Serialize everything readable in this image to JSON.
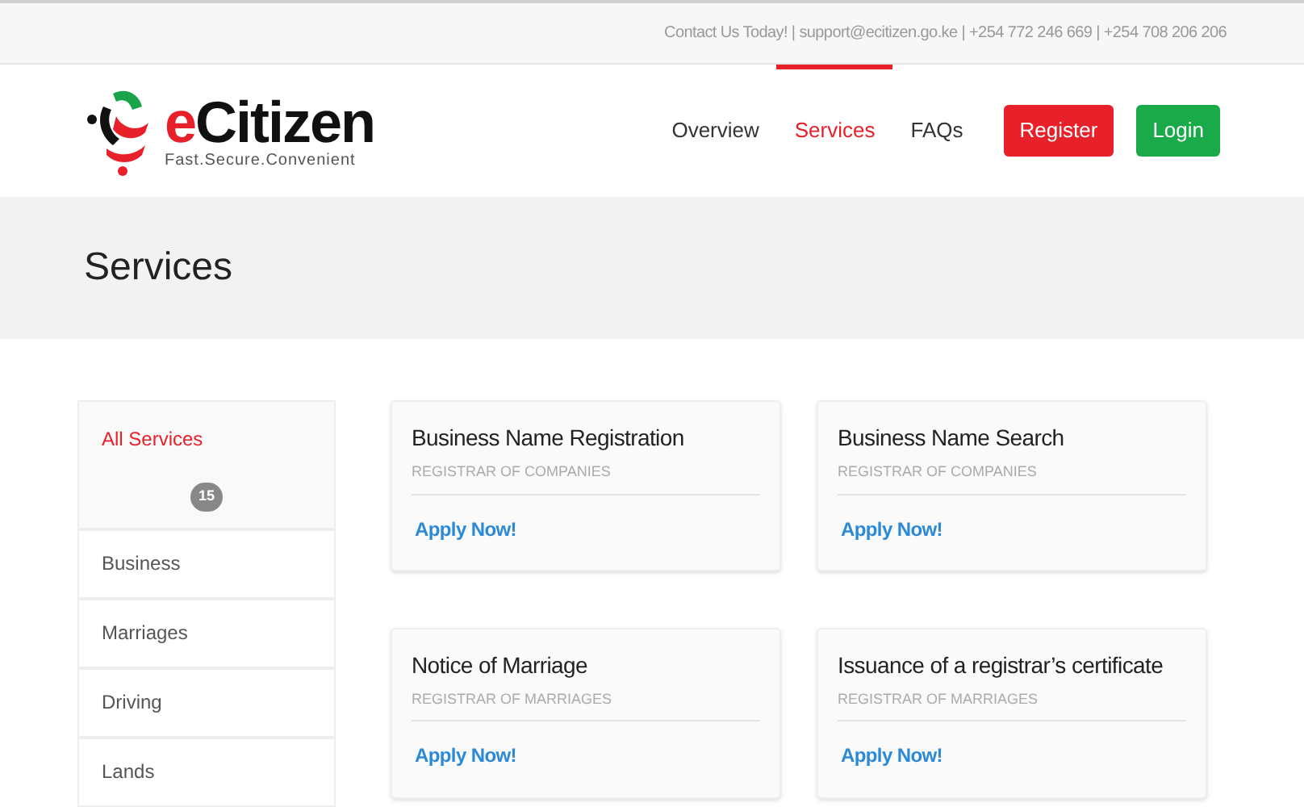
{
  "top_bar": {
    "contact": "Contact Us Today! | support@ecitizen.go.ke | +254 772 246 669 | +254 708 206 206"
  },
  "logo": {
    "accent": "e",
    "name": "Citizen",
    "tagline": "Fast.Secure.Convenient"
  },
  "nav": [
    {
      "label": "Overview",
      "selected": false
    },
    {
      "label": "Services",
      "selected": true
    },
    {
      "label": "FAQs",
      "selected": false
    }
  ],
  "buttons": [
    {
      "label": "Register",
      "kind": "register"
    },
    {
      "label": "Login",
      "kind": "login"
    }
  ],
  "page_title": "Services",
  "sidebar": {
    "items": [
      {
        "label": "All Services",
        "selected": true,
        "count": "15"
      },
      {
        "label": "Business",
        "selected": false
      },
      {
        "label": "Marriages",
        "selected": false
      },
      {
        "label": "Driving",
        "selected": false
      },
      {
        "label": "Lands",
        "selected": false
      }
    ]
  },
  "cards": [
    {
      "title": "Business Name Registration",
      "subtitle": "REGISTRAR OF COMPANIES",
      "action": "Apply Now!"
    },
    {
      "title": "Business Name Search",
      "subtitle": "REGISTRAR OF COMPANIES",
      "action": "Apply Now!"
    },
    {
      "title": "Notice of Marriage",
      "subtitle": "REGISTRAR OF MARRIAGES",
      "action": "Apply Now!"
    },
    {
      "title": "Issuance of a registrar’s certificate",
      "subtitle": "REGISTRAR OF MARRIAGES",
      "action": "Apply Now!"
    }
  ]
}
